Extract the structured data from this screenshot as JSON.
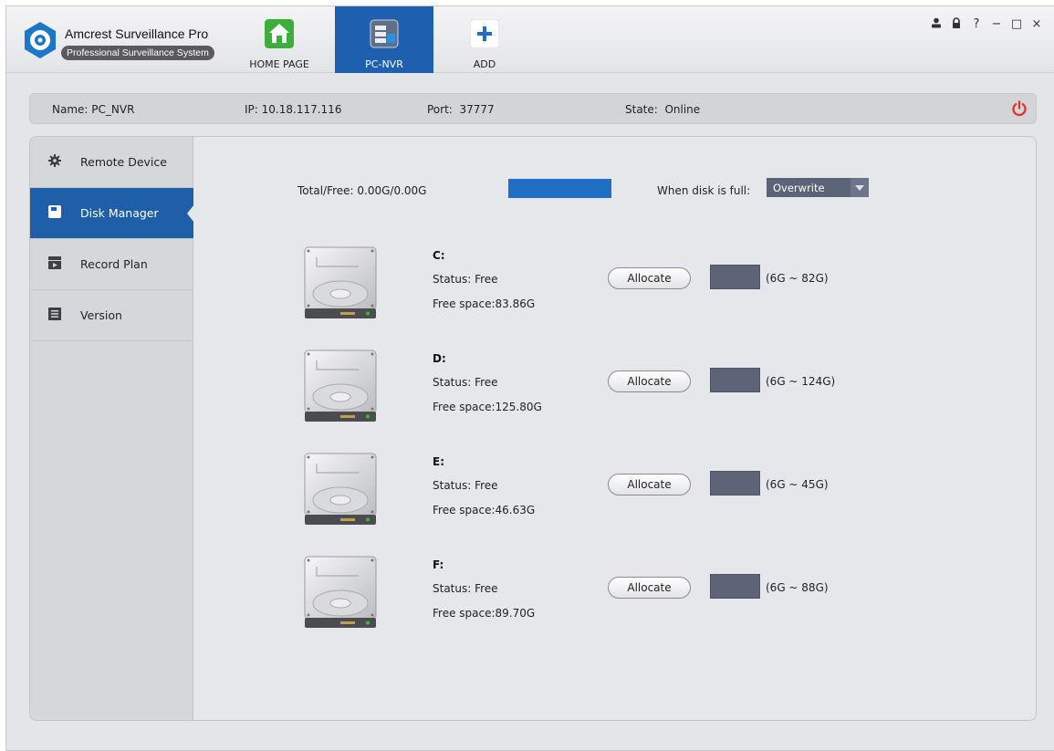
{
  "app": {
    "name": "Amcrest Surveillance Pro",
    "subtitle": "Professional Surveillance System"
  },
  "tabs": [
    {
      "label": "HOME PAGE",
      "icon": "home-icon",
      "active": false
    },
    {
      "label": "PC-NVR",
      "icon": "pc-nvr-icon",
      "active": true
    },
    {
      "label": "ADD",
      "icon": "plus-icon",
      "active": false
    }
  ],
  "window_controls": {
    "user": "👤",
    "lock": "🔒",
    "help": "?",
    "minimize": "−",
    "maximize": "□",
    "close": "×"
  },
  "device": {
    "name_label": "Name:",
    "name": "PC_NVR",
    "ip_label": "IP:",
    "ip": "10.18.117.116",
    "port_label": "Port:",
    "port": "37777",
    "state_label": "State:",
    "state": "Online"
  },
  "sidebar": {
    "items": [
      {
        "label": "Remote Device",
        "icon": "gear-icon",
        "active": false
      },
      {
        "label": "Disk Manager",
        "icon": "disk-icon",
        "active": true
      },
      {
        "label": "Record Plan",
        "icon": "clapperboard-icon",
        "active": false
      },
      {
        "label": "Version",
        "icon": "document-icon",
        "active": false
      }
    ]
  },
  "disk_manager": {
    "total_free": "Total/Free: 0.00G/0.00G",
    "usage_fraction": 1.0,
    "when_full_label": "When disk is full:",
    "when_full_value": "Overwrite",
    "allocate_label": "Allocate",
    "disks": [
      {
        "name": "C:",
        "status": "Status: Free",
        "free": "Free space:83.86G",
        "range": "(6G ~ 82G)"
      },
      {
        "name": "D:",
        "status": "Status: Free",
        "free": "Free space:125.80G",
        "range": "(6G ~ 124G)"
      },
      {
        "name": "E:",
        "status": "Status: Free",
        "free": "Free space:46.63G",
        "range": "(6G ~ 45G)"
      },
      {
        "name": "F:",
        "status": "Status: Free",
        "free": "Free space:89.70G",
        "range": "(6G ~ 88G)"
      }
    ]
  },
  "colors": {
    "accent": "#1f5ea8",
    "power": "#e0382b",
    "usage_bar": "#1e70c4",
    "select_bg": "#5a6378"
  }
}
